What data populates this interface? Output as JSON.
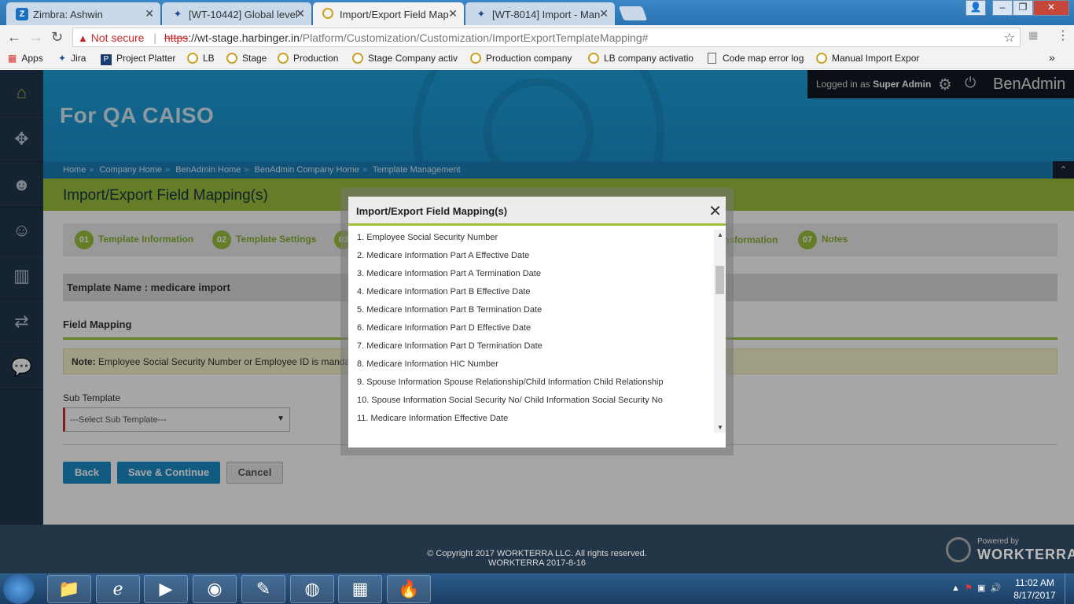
{
  "browser": {
    "tabs": [
      {
        "title": "Zimbra: Ashwin",
        "icon": "Z"
      },
      {
        "title": "[WT-10442] Global level",
        "icon": "jira"
      },
      {
        "title": "Import/Export Field Map",
        "icon": "worktera"
      },
      {
        "title": "[WT-8014] Import - Man",
        "icon": "jira"
      }
    ],
    "address": {
      "not_secure": "Not secure",
      "scheme": "https",
      "host": "://wt-stage.harbinger.in",
      "path": "/Platform/Customization/Customization/ImportExportTemplateMapping#"
    },
    "bookmarks": [
      "Apps",
      "Jira",
      "Project Platter",
      "LB",
      "Stage",
      "Production",
      "Stage Company activ",
      "Production company",
      "LB company activatio",
      "Code map error log",
      "Manual Import Expor"
    ],
    "overflow": "»"
  },
  "app": {
    "company_title": "For QA CAISO",
    "user": {
      "logged_prefix": "Logged in as",
      "user_name": "Super Admin",
      "brand": "BenAdmin"
    },
    "breadcrumb": [
      "Home",
      "Company Home",
      "BenAdmin Home",
      "BenAdmin Company Home",
      "Template Management"
    ],
    "page_title": "Import/Export Field Mapping(s)",
    "steps": [
      {
        "num": "01",
        "label": "Template Information"
      },
      {
        "num": "02",
        "label": "Template Settings"
      },
      {
        "num": "03",
        "label": ""
      },
      {
        "num": "",
        "label": "nsformation"
      },
      {
        "num": "07",
        "label": "Notes"
      }
    ],
    "template_name": "Template Name : medicare import",
    "field_mapping": "Field Mapping",
    "note_label": "Note:",
    "note_text": "Employee Social Security Number or Employee ID is mandatory fo",
    "sub_template_label": "Sub Template",
    "sub_template_value": "---Select Sub Template---",
    "buttons": {
      "back": "Back",
      "save": "Save & Continue",
      "cancel": "Cancel"
    }
  },
  "modal": {
    "title": "Import/Export Field Mapping(s)",
    "items": [
      "1. Employee Social Security Number",
      "2. Medicare Information Part A Effective Date",
      "3. Medicare Information Part A Termination Date",
      "4. Medicare Information Part B Effective Date",
      "5. Medicare Information Part B Termination Date",
      "6. Medicare Information Part D Effective Date",
      "7. Medicare Information Part D Termination Date",
      "8. Medicare Information HIC Number",
      "9. Spouse Information Spouse Relationship/Child Information Child Relationship",
      "10. Spouse Information Social Security No/ Child Information Social Security No",
      "11. Medicare Information Effective Date"
    ]
  },
  "footer": {
    "copyright": "© Copyright 2017 WORKTERRA LLC. All rights reserved.",
    "version": "WORKTERRA 2017-8-16",
    "powered_by": "Powered by",
    "powered_name": "WORKTERRA"
  },
  "taskbar": {
    "time": "11:02 AM",
    "date": "8/17/2017"
  },
  "colors": {
    "accent_green": "#9bc13c",
    "banner_blue": "#1da1dc",
    "sidebar": "#23374f",
    "button_blue": "#1b8dc8"
  }
}
